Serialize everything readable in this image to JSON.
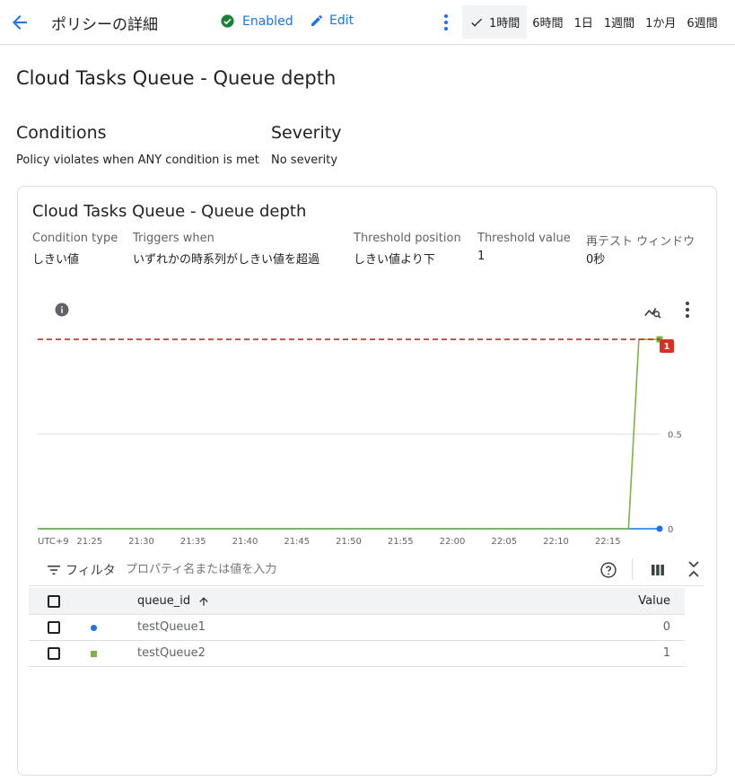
{
  "header": {
    "page_title": "ポリシーの詳細",
    "status_label": "Enabled",
    "edit_label": "Edit",
    "time_ranges": [
      "1時間",
      "6時間",
      "1日",
      "1週間",
      "1か月",
      "6週間"
    ],
    "selected_time_range": "1時間"
  },
  "policy": {
    "name": "Cloud Tasks Queue - Queue depth",
    "conditions_heading": "Conditions",
    "conditions_text": "Policy violates when ANY condition is met",
    "severity_heading": "Severity",
    "severity_text": "No severity"
  },
  "condition_card": {
    "title": "Cloud Tasks Queue - Queue depth",
    "fields": [
      {
        "label": "Condition type",
        "value": "しきい値"
      },
      {
        "label": "Triggers when",
        "value": "いずれかの時系列がしきい値を超過"
      },
      {
        "label": "Threshold position",
        "value": "しきい値より下"
      },
      {
        "label": "Threshold value",
        "value": "1"
      },
      {
        "label": "再テスト ウィンドウ",
        "value": "0秒"
      }
    ]
  },
  "chart_data": {
    "type": "line",
    "x_tick_labels": [
      "UTC+9",
      "21:25",
      "21:30",
      "21:35",
      "21:40",
      "21:45",
      "21:50",
      "21:55",
      "22:00",
      "22:05",
      "22:10",
      "22:15"
    ],
    "y_tick_labels": [
      "0",
      "0.5"
    ],
    "ylim": [
      0,
      1
    ],
    "threshold": 1,
    "threshold_badge": "1",
    "threshold_color": "#a52714",
    "series": [
      {
        "name": "testQueue1",
        "color": "#1a73e8",
        "marker": "circle",
        "points": [
          [
            "21:20",
            0
          ],
          [
            "22:20",
            0
          ]
        ]
      },
      {
        "name": "testQueue2",
        "color": "#7cb342",
        "marker": "square",
        "points": [
          [
            "21:20",
            0
          ],
          [
            "22:17",
            0
          ],
          [
            "22:18",
            1
          ],
          [
            "22:20",
            1
          ]
        ]
      }
    ]
  },
  "filter": {
    "label": "フィルタ",
    "placeholder": "プロパティ名または値を入力"
  },
  "table": {
    "columns": {
      "id": "queue_id",
      "value": "Value"
    },
    "rows": [
      {
        "queue_id": "testQueue1",
        "value": "0",
        "color": "#1a73e8",
        "marker": "circle"
      },
      {
        "queue_id": "testQueue2",
        "value": "1",
        "color": "#7cb342",
        "marker": "square"
      }
    ]
  }
}
